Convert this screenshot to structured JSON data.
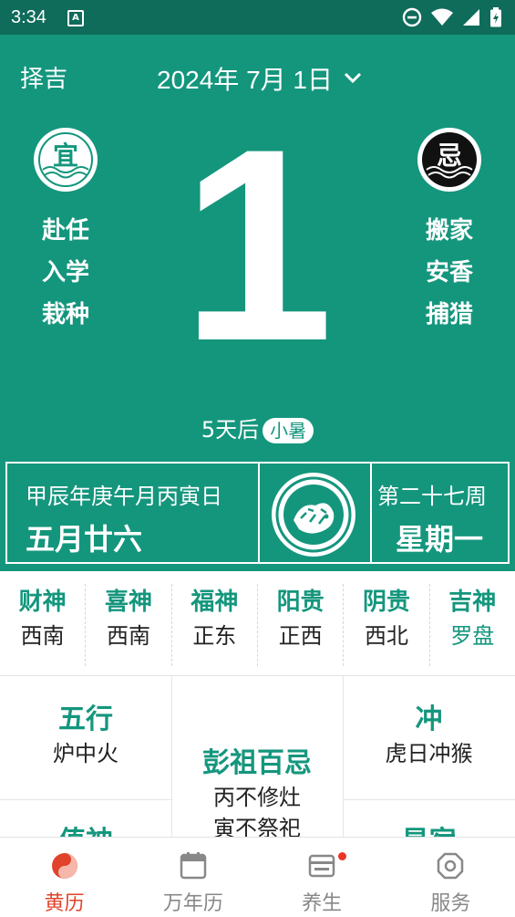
{
  "status": {
    "time": "3:34",
    "a_badge": "A"
  },
  "header": {
    "zeji_label": "择吉",
    "date_label": "2024年 7月 1日"
  },
  "day_number": "1",
  "yi": {
    "badge": "宜",
    "items": [
      "赴任",
      "入学",
      "栽种"
    ]
  },
  "ji": {
    "badge": "忌",
    "items": [
      "搬家",
      "安香",
      "捕猎"
    ]
  },
  "countdown": {
    "text": "5天后",
    "term": "小暑"
  },
  "info": {
    "ganzhi": "甲辰年庚午月丙寅日",
    "lunar": "五月廿六",
    "week": "第二十七周",
    "weekday": "星期一"
  },
  "gods": [
    {
      "name": "财神",
      "dir": "西南"
    },
    {
      "name": "喜神",
      "dir": "西南"
    },
    {
      "name": "福神",
      "dir": "正东"
    },
    {
      "name": "阳贵",
      "dir": "正西"
    },
    {
      "name": "阴贵",
      "dir": "西北"
    },
    {
      "name": "吉神",
      "dir": "罗盘"
    }
  ],
  "grid": {
    "wuxing": {
      "title": "五行",
      "value": "炉中火"
    },
    "pengzu": {
      "title": "彭祖百忌",
      "line1": "丙不修灶",
      "line2": "寅不祭祀"
    },
    "chong": {
      "title": "冲",
      "value": "虎日冲猴"
    },
    "bottom_left": "值神",
    "bottom_right": "星宿"
  },
  "nav": [
    {
      "label": "黄历"
    },
    {
      "label": "万年历"
    },
    {
      "label": "养生"
    },
    {
      "label": "服务"
    }
  ],
  "colors": {
    "primary": "#14967d",
    "statusbar": "#0f6b5a",
    "accent": "#e0432b"
  }
}
